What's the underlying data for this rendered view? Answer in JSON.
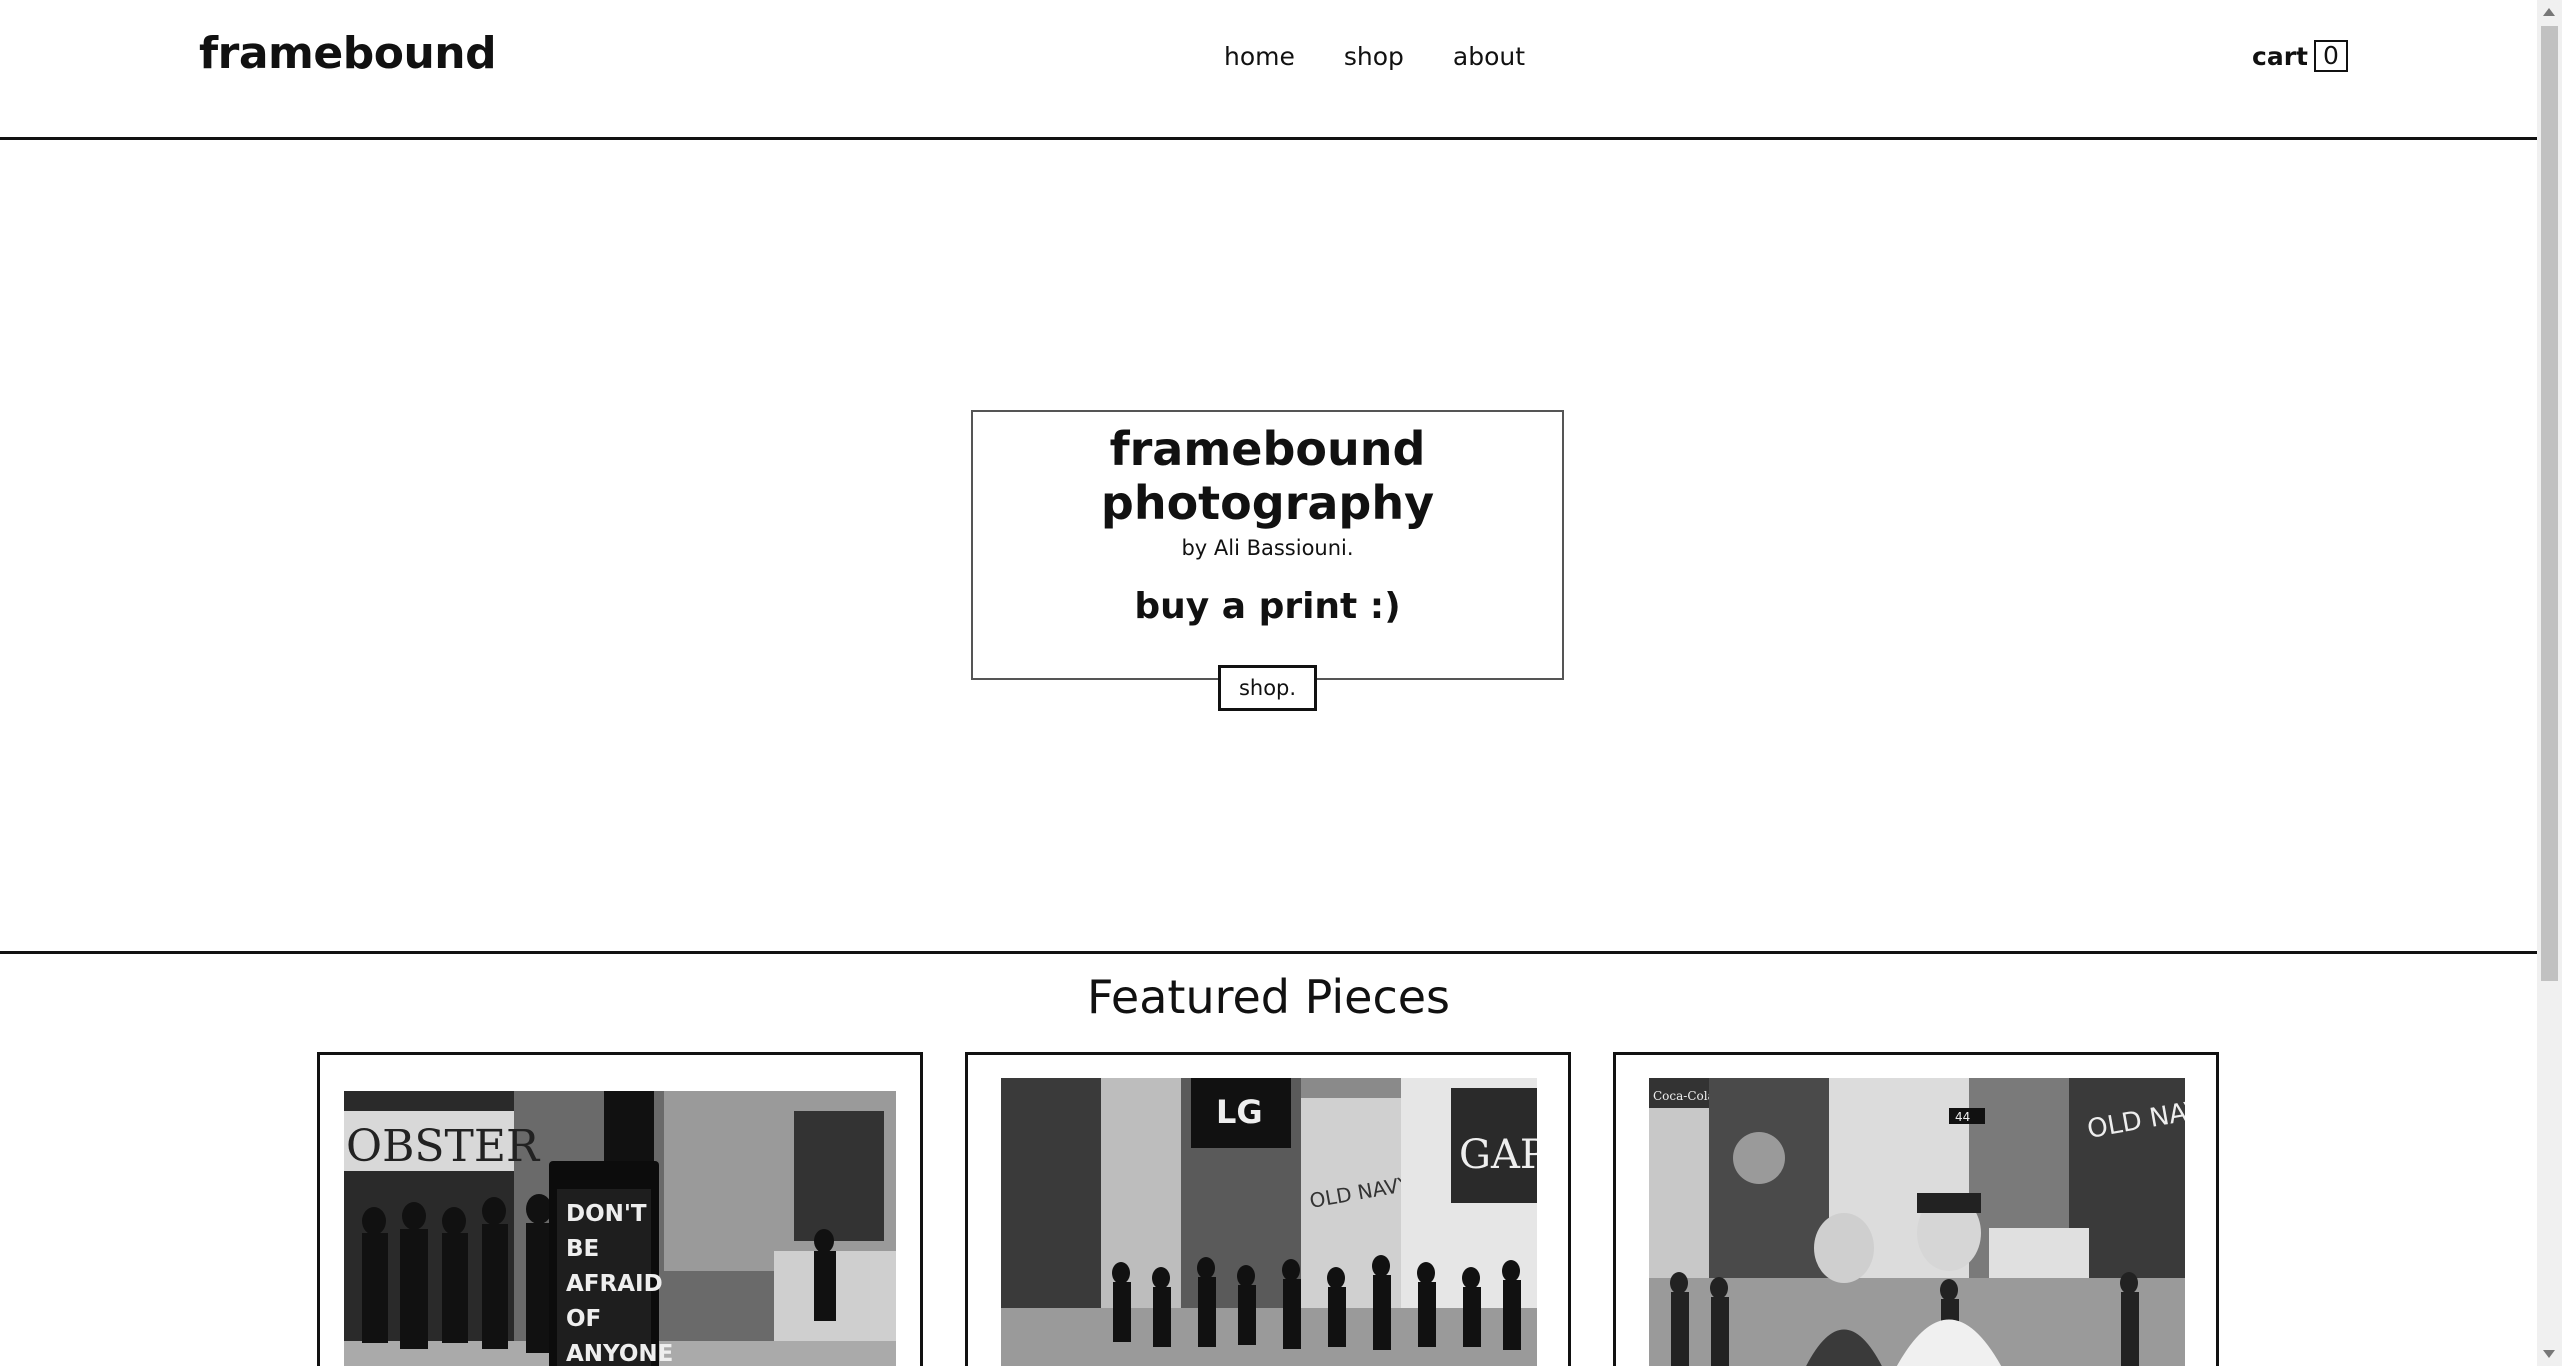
{
  "header": {
    "logo": "framebound",
    "nav": [
      {
        "label": "home"
      },
      {
        "label": "shop"
      },
      {
        "label": "about"
      }
    ],
    "cart_label": "cart",
    "cart_count": "0"
  },
  "hero": {
    "title": "framebound photography",
    "subtitle": "by Ali Bassiouni.",
    "cta": "buy a print :)",
    "button_label": "shop."
  },
  "featured": {
    "title": "Featured Pieces",
    "items": [
      {
        "sign_lines": [
          "DON'T",
          "BE",
          "AFRAID",
          "OF",
          "ANYONE"
        ],
        "store_text": "OBSTER"
      },
      {
        "sign_text": "LG",
        "store_text": "GAP",
        "banner_text": "OLD NAVY"
      },
      {
        "sign_text": "Coca-Cola",
        "banner_text": "OLD NAVY",
        "street_sign": "44"
      }
    ]
  }
}
